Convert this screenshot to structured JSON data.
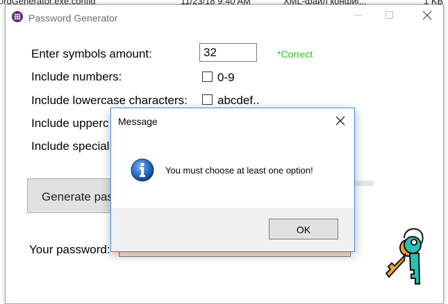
{
  "background": {
    "items": [
      "ordGenerator.exe.config",
      "11/23/18 9:40 AM",
      "XML-файл конфиг...",
      "1 KB"
    ]
  },
  "window": {
    "title": "Password Generator",
    "controls": {
      "minimize": "minimize",
      "maximize": "maximize",
      "close": "close"
    }
  },
  "form": {
    "amount_label": "Enter symbols amount:",
    "amount_value": "32",
    "amount_status": "*Correct",
    "numbers_label": "Include numbers:",
    "numbers_option": "0-9",
    "lowercase_label": "Include lowercase characters:",
    "lowercase_option": "abcdef..",
    "uppercase_label": "Include upperc",
    "special_label": "Include special",
    "generate_label": "Generate pas",
    "password_label": "Your password:"
  },
  "dialog": {
    "title": "Message",
    "message": "You must choose at least one option!",
    "ok_label": "OK"
  },
  "colors": {
    "status_ok": "#27c227",
    "dialog_border": "#3f8edc",
    "info_blue": "#1f5fb5",
    "key_teal": "#26c3b4",
    "key_orange": "#f5a623"
  },
  "icons": [
    "app-icon",
    "info-icon",
    "keys-icon",
    "close-icon"
  ]
}
